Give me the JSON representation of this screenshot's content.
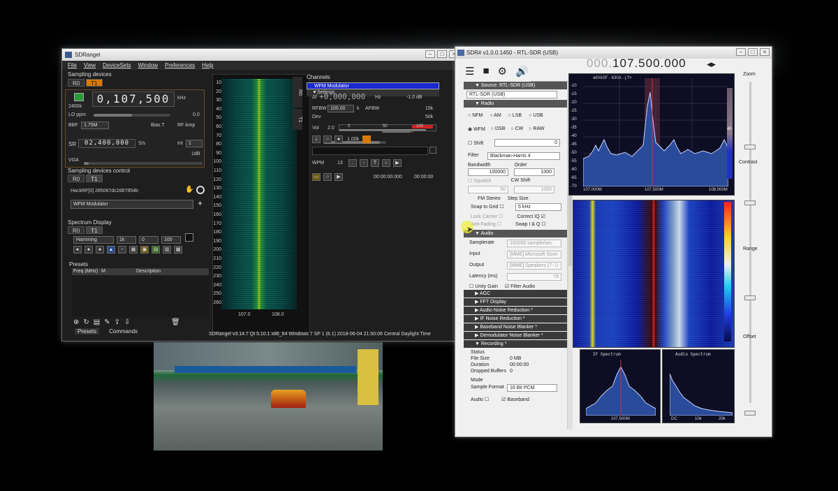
{
  "sdrangel": {
    "title": "SDRangel",
    "menu": [
      "File",
      "View",
      "DeviceSets",
      "Window",
      "Preferences",
      "Help"
    ],
    "sampling_devices": "Sampling devices",
    "tabs": [
      "R0",
      "T1"
    ],
    "rate": "2400k",
    "frequency": "0,107,500",
    "freq_unit": "kHz",
    "lo_ppm_label": "LO ppm",
    "lo_ppm_value": "0.0",
    "bbf_label": "BBF",
    "bbf_value": "1.75M",
    "bias_t": "Bias T",
    "rf_amp": "RF Amp",
    "sr_label": "SR",
    "sr_value": "02,400,000",
    "sr_unit": "S/s",
    "int_label": "Int",
    "int_value": "1",
    "vga_label": "VGA",
    "db_value": "1dB",
    "sdc": "Sampling devices control",
    "sdc_tabs": [
      "R0",
      "T1"
    ],
    "device": "HackRF[0] 285067dc2d87854b",
    "channel_select": "WFM Modulator",
    "spectrum_display": "Spectrum Display",
    "spec_tabs": [
      "R0",
      "T1"
    ],
    "window_fn": "Hamming",
    "fft_size": "1k",
    "spec_a": "0",
    "spec_b": "100",
    "presets": "Presets",
    "presets_cols": [
      "Freq (MHz)",
      "M",
      "Description"
    ],
    "bottom_tabs": [
      "Presets",
      "Commands"
    ],
    "status": "SDRangel v3.14.7 Qt 5.10.1 x86_64 Windows 7 SP 1 (6.1)   2018-06-04 21:50:06 Central Daylight Time",
    "wf_y": [
      "10",
      "20",
      "30",
      "40",
      "50",
      "60",
      "70",
      "80",
      "90",
      "100",
      "110",
      "120",
      "130",
      "140",
      "150",
      "160",
      "170",
      "180",
      "190",
      "200",
      "210",
      "220",
      "230",
      "240",
      "250",
      "260"
    ],
    "wf_x": [
      "107.0",
      "108.0"
    ],
    "side_tabs": [
      "R0",
      "T1"
    ],
    "channels": {
      "title": "Channels",
      "plugin": "WFM Modulator",
      "settings": "Settings",
      "delta_label": "Δf",
      "delta": "+0,000,000",
      "delta_unit": "Hz",
      "level": "-1.0 dB",
      "rfbw_label": "RFBW",
      "rfbw": "100.00",
      "rfbw_unit": "k",
      "afbw_label": "AFBW",
      "afbw_val": "15k",
      "dev_label": "Dev",
      "dev_val": "50k",
      "vol_label": "Vol",
      "vol_val": "2.0",
      "scale": [
        "0",
        "50",
        "100"
      ],
      "tone": "1.00k",
      "wpm_label": "WPM",
      "wpm": "13",
      "t_label": "T",
      "time1": "00:00:00.000",
      "time2": "00:00:00"
    }
  },
  "sdrsharp": {
    "title": "SDR# v1.0.0.1450 - RTL-SDR (USB)",
    "freq_dim": "000.",
    "freq": "107.500.000",
    "source_hdr": "Source: RTL-SDR (USB)",
    "source_val": "RTL-SDR (USB)",
    "radio_hdr": "Radio",
    "modes_row1": [
      "NFM",
      "AM",
      "LSB",
      "USB"
    ],
    "modes_row2": [
      "WFM",
      "DSB",
      "CW",
      "RAW"
    ],
    "shift": "Shift",
    "shift_val": "0",
    "filter_label": "Filter",
    "filter_val": "Blackman-Harris 4",
    "bandwidth_label": "Bandwidth",
    "bandwidth": "100000",
    "order_label": "Order",
    "order": "1000",
    "squelch": "Squelch",
    "cw_shift": "CW Shift",
    "sq_val": "50",
    "cw_val": "1000",
    "fm_stereo": "FM Stereo",
    "step_size": "Step Size",
    "snap": "Snap to Grid",
    "step_val": "5 kHz",
    "lock_carrier": "Lock Carrier",
    "correct_iq": "Correct IQ",
    "anti_fading": "Anti-Fading",
    "swap_iq": "Swap I & Q",
    "audio_hdr": "Audio",
    "samplerate_label": "Samplerate",
    "samplerate": "192000 sample/sec",
    "input_label": "Input",
    "input": "[MME] Microsoft Soun",
    "output_label": "Output",
    "output": "[MME] Speakers (7- U",
    "latency_label": "Latency (ms)",
    "latency": "79",
    "unity_gain": "Unity Gain",
    "filter_audio": "Filter Audio",
    "sections": [
      "AGC",
      "FFT Display",
      "Audio Noise Reduction *",
      "IF Noise Reduction *",
      "Baseband Noise Blanker *",
      "Demodulator Noise Blanker *"
    ],
    "recording_hdr": "Recording *",
    "status_label": "Status",
    "filesize_label": "File Size",
    "filesize": "0 MB",
    "duration_label": "Duration",
    "duration": "00:00:00",
    "dropped_label": "Dropped Buffers",
    "dropped": "0",
    "mode_label": "Mode",
    "sample_format_label": "Sample Format",
    "sample_format": "16 Bit PCM",
    "audio_chk": "Audio",
    "baseband_chk": "Baseband",
    "spec_header": "a6XkSF - 630A - j.?>",
    "spec_y": [
      "-10",
      "-15",
      "-20",
      "-25",
      "-30",
      "-35",
      "-40",
      "-45",
      "-50",
      "-55",
      "-60",
      "-65",
      "-70"
    ],
    "spec_x": [
      "107.000M",
      "107.500M",
      "108.000M"
    ],
    "scale_val": "40",
    "zoom": "Zoom",
    "contrast": "Contrast",
    "range": "Range",
    "offset": "Offset",
    "if_spectrum": "IF Spectrum",
    "if_x": "107.500M",
    "audio_spectrum": "Audio Spectrum",
    "audio_x": [
      "DC",
      "10k",
      "20k"
    ]
  }
}
